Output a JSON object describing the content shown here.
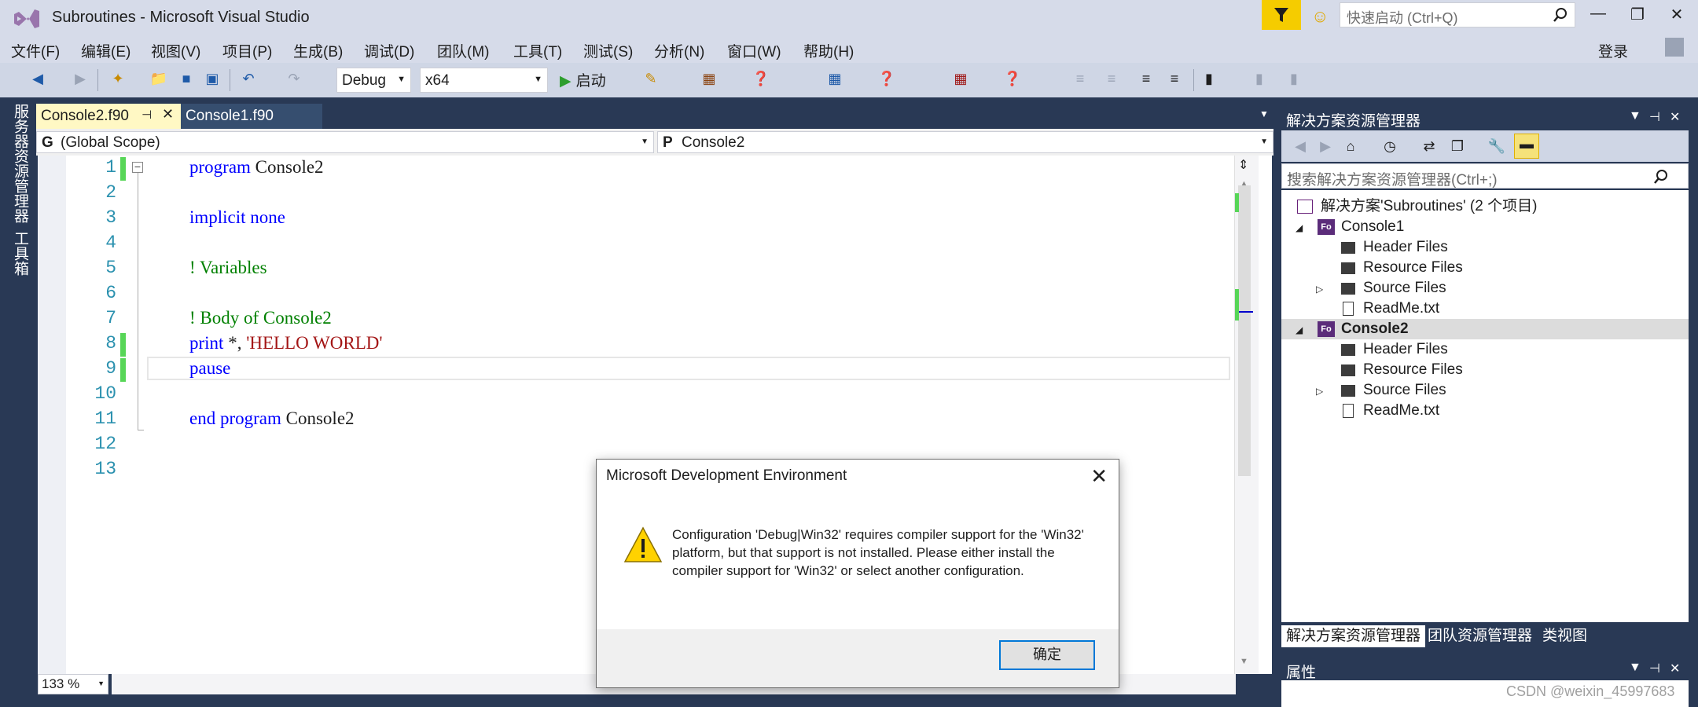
{
  "window": {
    "title": "Subroutines - Microsoft Visual Studio",
    "quick_launch_placeholder": "快速启动 (Ctrl+Q)",
    "login": "登录"
  },
  "menu": [
    "文件(F)",
    "编辑(E)",
    "视图(V)",
    "项目(P)",
    "生成(B)",
    "调试(D)",
    "团队(M)",
    "工具(T)",
    "测试(S)",
    "分析(N)",
    "窗口(W)",
    "帮助(H)"
  ],
  "toolbar": {
    "config": "Debug",
    "platform": "x64",
    "start": "启动"
  },
  "side_tabs": [
    "服务器资源管理器",
    "工具箱"
  ],
  "editor": {
    "tabs": [
      "Console2.f90",
      "Console1.f90"
    ],
    "scope_prefix": "G",
    "scope": "(Global Scope)",
    "proc_prefix": "P",
    "proc": "Console2",
    "zoom": "133 %",
    "line_numbers": [
      "1",
      "2",
      "3",
      "4",
      "5",
      "6",
      "7",
      "8",
      "9",
      "10",
      "11",
      "12",
      "13"
    ],
    "lines": {
      "l1_kw": "program",
      "l1_rest": " Console2",
      "l3_kw": "implicit none",
      "l5_cm": "! Variables",
      "l7_cm": "! Body of Console2",
      "l8_kw": "print",
      "l8_mid": " *, ",
      "l8_str": "'HELLO WORLD'",
      "l9_kw": "pause",
      "l11_kw": "end program",
      "l11_rest": " Console2"
    }
  },
  "solution_explorer": {
    "title": "解决方案资源管理器",
    "search_placeholder": "搜索解决方案资源管理器(Ctrl+;)",
    "solution": "解决方案'Subroutines' (2 个项目)",
    "projects": [
      {
        "name": "Console1",
        "children": [
          "Header Files",
          "Resource Files",
          "Source Files",
          "ReadMe.txt"
        ]
      },
      {
        "name": "Console2",
        "children": [
          "Header Files",
          "Resource Files",
          "Source Files",
          "ReadMe.txt"
        ]
      }
    ],
    "bottom_tabs": [
      "解决方案资源管理器",
      "团队资源管理器",
      "类视图"
    ]
  },
  "properties": {
    "title": "属性"
  },
  "watermark": "CSDN @weixin_45997683",
  "dialog": {
    "title": "Microsoft Development Environment",
    "message": "Configuration 'Debug|Win32' requires compiler support for the 'Win32' platform, but that support is not installed. Please either install the compiler support for 'Win32' or select another configuration.",
    "ok": "确定"
  }
}
